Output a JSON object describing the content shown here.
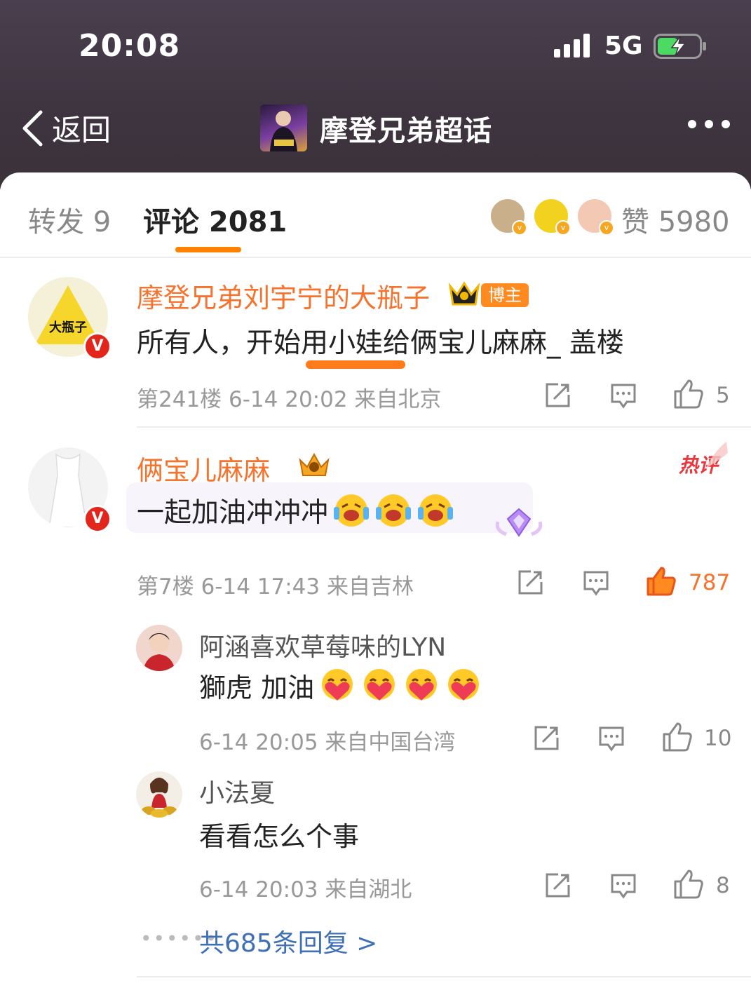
{
  "status_bar": {
    "time": "20:08",
    "network": "5G"
  },
  "nav": {
    "back_label": "返回",
    "title": "摩登兄弟超话"
  },
  "tabs": {
    "repost": "转发 9",
    "comment": "评论 2081",
    "like": "赞 5980"
  },
  "comments": [
    {
      "name": "摩登兄弟刘宇宁的大瓶子",
      "badge": "博主",
      "text": "所有人，开始用小娃给俩宝儿麻麻_ 盖楼",
      "meta": "第241楼 6-14 20:02  来自北京",
      "likes": "5",
      "avatar_text": "大瓶子"
    },
    {
      "name": "俩宝儿麻麻_",
      "hot_tag": "热评",
      "text": "一起加油冲冲冲",
      "meta": "第7楼 6-14 17:43  来自吉林",
      "likes": "787"
    }
  ],
  "replies": [
    {
      "name": "阿涵喜欢草莓味的LYN",
      "text": "獅虎 加油",
      "meta": "6-14 20:05  来自中国台湾",
      "likes": "10"
    },
    {
      "name": "小法夏",
      "text": "看看怎么个事",
      "meta": "6-14 20:03  来自湖北",
      "likes": "8"
    }
  ],
  "total_replies": "共685条回复 >",
  "colors": {
    "accent": "#ff8200",
    "name": "#f7722c",
    "link": "#3f6fb4",
    "header_bg": "#3f3541"
  }
}
